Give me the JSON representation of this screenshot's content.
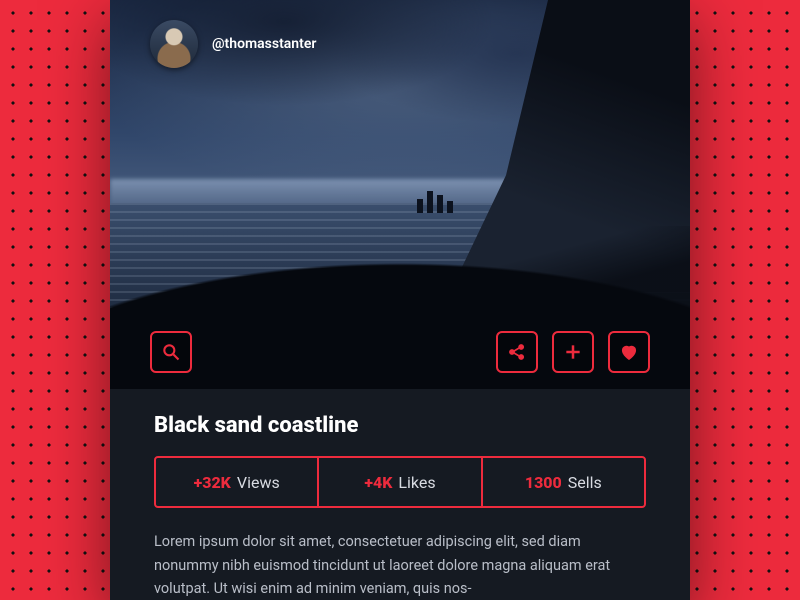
{
  "user": {
    "handle": "@thomasstanter"
  },
  "title": "Black sand coastline",
  "stats": {
    "views": {
      "num": "+32K",
      "label": "Views"
    },
    "likes": {
      "num": "+4K",
      "label": "Likes"
    },
    "sells": {
      "num": "1300",
      "label": "Sells"
    }
  },
  "description": "Lorem ipsum dolor sit amet, consectetuer adipiscing elit, sed diam nonummy nibh euismod tincidunt ut laoreet dolore magna aliquam erat volutpat. Ut wisi enim ad minim veniam, quis nos-",
  "colors": {
    "accent": "#ed2b3d",
    "panel": "#151a22"
  },
  "icons": {
    "zoom": "search-icon",
    "share": "share-icon",
    "add": "plus-icon",
    "like": "heart-icon"
  }
}
